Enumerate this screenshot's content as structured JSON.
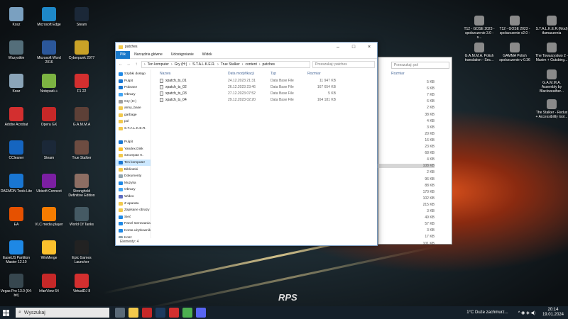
{
  "desktop_icons": [
    {
      "label": "Kosz",
      "color": "#7aa0c0"
    },
    {
      "label": "Microsoft Edge",
      "color": "#1e88c8"
    },
    {
      "label": "Steam",
      "color": "#1b2838"
    },
    {
      "label": "Wszystkie",
      "color": "#546e7a"
    },
    {
      "label": "Microsoft Word 2016",
      "color": "#2b579a"
    },
    {
      "label": "Cyberpunk 2077",
      "color": "#c9a227"
    },
    {
      "label": "Kosz",
      "color": "#8aa4b8"
    },
    {
      "label": "Notepad++",
      "color": "#7cb342"
    },
    {
      "label": "F1 22",
      "color": "#d32f2f"
    },
    {
      "label": "Adobe Acrobat",
      "color": "#d32f2f"
    },
    {
      "label": "Opera GX",
      "color": "#c62828"
    },
    {
      "label": "G.A.M.M.A",
      "color": "#5d4037"
    },
    {
      "label": "CCleaner",
      "color": "#1565c0"
    },
    {
      "label": "Steam",
      "color": "#1b2838"
    },
    {
      "label": "True Stalker",
      "color": "#6d4c41"
    },
    {
      "label": "DAEMON Tools Lite",
      "color": "#1976d2"
    },
    {
      "label": "Ubisoft Connect",
      "color": "#7b1fa2"
    },
    {
      "label": "Stronghold Definitive Edition",
      "color": "#8d6e63"
    },
    {
      "label": "EA",
      "color": "#e65100"
    },
    {
      "label": "VLC media player",
      "color": "#f57c00"
    },
    {
      "label": "World Of Tanks",
      "color": "#455a64"
    },
    {
      "label": "EaseUS Partition Master 12.10",
      "color": "#1e88e5"
    },
    {
      "label": "WinMerge",
      "color": "#fbc02d"
    },
    {
      "label": "Epic Games Launcher",
      "color": "#222222"
    },
    {
      "label": "Vegas Pro 13.0 (64-bit)",
      "color": "#37474f"
    },
    {
      "label": "IrfanView 64",
      "color": "#c62828"
    },
    {
      "label": "VirtualDJ 8",
      "color": "#d32f2f"
    }
  ],
  "right_icons": [
    {
      "label": "T12 - GOSE 2023 - spolszczenie 3.0 - s...",
      "color": "#8a8a8a"
    },
    {
      "label": "T12 - GOSE 2023 - spolszczenie v2.0 -",
      "color": "#8a8a8a"
    },
    {
      "label": "S.T.A.L.K.E.R.(Mod) tłumaczenia",
      "color": "#8a8a8a"
    },
    {
      "label": "G.A.M.M.A. Polish translation - Sec...",
      "color": "#8a8a8a"
    },
    {
      "label": "GAMMA Polish spolszczenie v 0.36",
      "color": "#8a8a8a"
    },
    {
      "label": "The Towarzystwo 2 - Maxim + Gutsbing...",
      "color": "#8a8a8a"
    },
    {
      "label": "G.A.M.M.A. Assembly by Blackweather...",
      "color": "#8a8a8a"
    },
    {
      "label": "The Stalker - Redux + Accessibility tool...",
      "color": "#8a8a8a"
    }
  ],
  "back_window": {
    "search_placeholder": "Przeszukaj: pol",
    "size_header": "Rozmiar",
    "sizes": [
      "5 KB",
      "6 KB",
      "7 KB",
      "6 KB",
      "2 KB",
      "38 KB",
      "4 KB",
      "3 KB",
      "20 KB",
      "16 KB",
      "23 KB",
      "68 KB",
      "4 KB",
      "108 KB",
      "2 KB",
      "96 KB",
      "88 KB",
      "170 KB",
      "102 KB",
      "215 KB",
      "3 KB",
      "49 KB",
      "57 KB",
      "3 KB",
      "17 KB",
      "101 KB"
    ]
  },
  "window": {
    "title": "patches",
    "tabs": [
      "Plik",
      "Narzędzia główne",
      "Udostępnianie",
      "Widok"
    ],
    "breadcrumb": [
      "Ten komputer",
      "Gry (H:)",
      "S.T.A.L.K.E.R.",
      "True Stalker",
      "content",
      "patches"
    ],
    "search_placeholder": "Przeszukaj: patches",
    "nav_items": [
      {
        "label": "Szybki dostęp",
        "color": "#1e88e5"
      },
      {
        "label": "Pulpit",
        "color": "#1976d2"
      },
      {
        "label": "Pobrane",
        "color": "#1976d2"
      },
      {
        "label": "Obrazy",
        "color": "#42a5f5"
      },
      {
        "label": "Gry (H:)",
        "color": "#9e9e9e"
      },
      {
        "label": "army_base",
        "color": "#f2c94c"
      },
      {
        "label": "garbage",
        "color": "#f2c94c"
      },
      {
        "label": "pol",
        "color": "#f2c94c"
      },
      {
        "label": "S.T.A.L.K.E.R.",
        "color": "#f2c94c"
      },
      {
        "label": "",
        "color": "#ffffff"
      },
      {
        "label": "Pulpit",
        "color": "#1976d2"
      },
      {
        "label": "Yandex.Disk",
        "color": "#fbc02d"
      },
      {
        "label": "Szczepan K.",
        "color": "#f2c94c"
      },
      {
        "label": "Ten komputer",
        "color": "#1976d2"
      },
      {
        "label": "Biblioteki",
        "color": "#f2c94c"
      },
      {
        "label": "Dokumenty",
        "color": "#90a4ae"
      },
      {
        "label": "Muzyka",
        "color": "#1e88e5"
      },
      {
        "label": "Obrazy",
        "color": "#42a5f5"
      },
      {
        "label": "Wideo",
        "color": "#5c6bc0"
      },
      {
        "label": "Z aparatu",
        "color": "#f2c94c"
      },
      {
        "label": "Zapisane obrazy",
        "color": "#f2c94c"
      },
      {
        "label": "Sieć",
        "color": "#1e88e5"
      },
      {
        "label": "Panel sterowania",
        "color": "#1e88e5"
      },
      {
        "label": "Konta użytkowników",
        "color": "#1e88e5"
      },
      {
        "label": "Kosz",
        "color": "#90a4ae"
      }
    ],
    "columns": [
      "Nazwa",
      "Data modyfikacji",
      "Typ",
      "Rozmiar"
    ],
    "files": [
      {
        "name": "xpatch_ts_01",
        "date": "24.12.2023 21:31",
        "type": "Data Base File",
        "size": "11 947 KB"
      },
      {
        "name": "xpatch_ts_02",
        "date": "26.12.2023 23:46",
        "type": "Data Base File",
        "size": "167 654 KB"
      },
      {
        "name": "xpatch_ts_03",
        "date": "27.12.2023 07:52",
        "type": "Data Base File",
        "size": "5 KB"
      },
      {
        "name": "xpatch_ts_04",
        "date": "29.12.2023 02:20",
        "type": "Data Base File",
        "size": "164 181 KB"
      }
    ],
    "status": "Elementy: 4"
  },
  "taskbar": {
    "search_label": "Wyszukaj",
    "weather": "1°C  Duże zachmurz...",
    "time": "20:14",
    "date": "19.01.2024"
  }
}
